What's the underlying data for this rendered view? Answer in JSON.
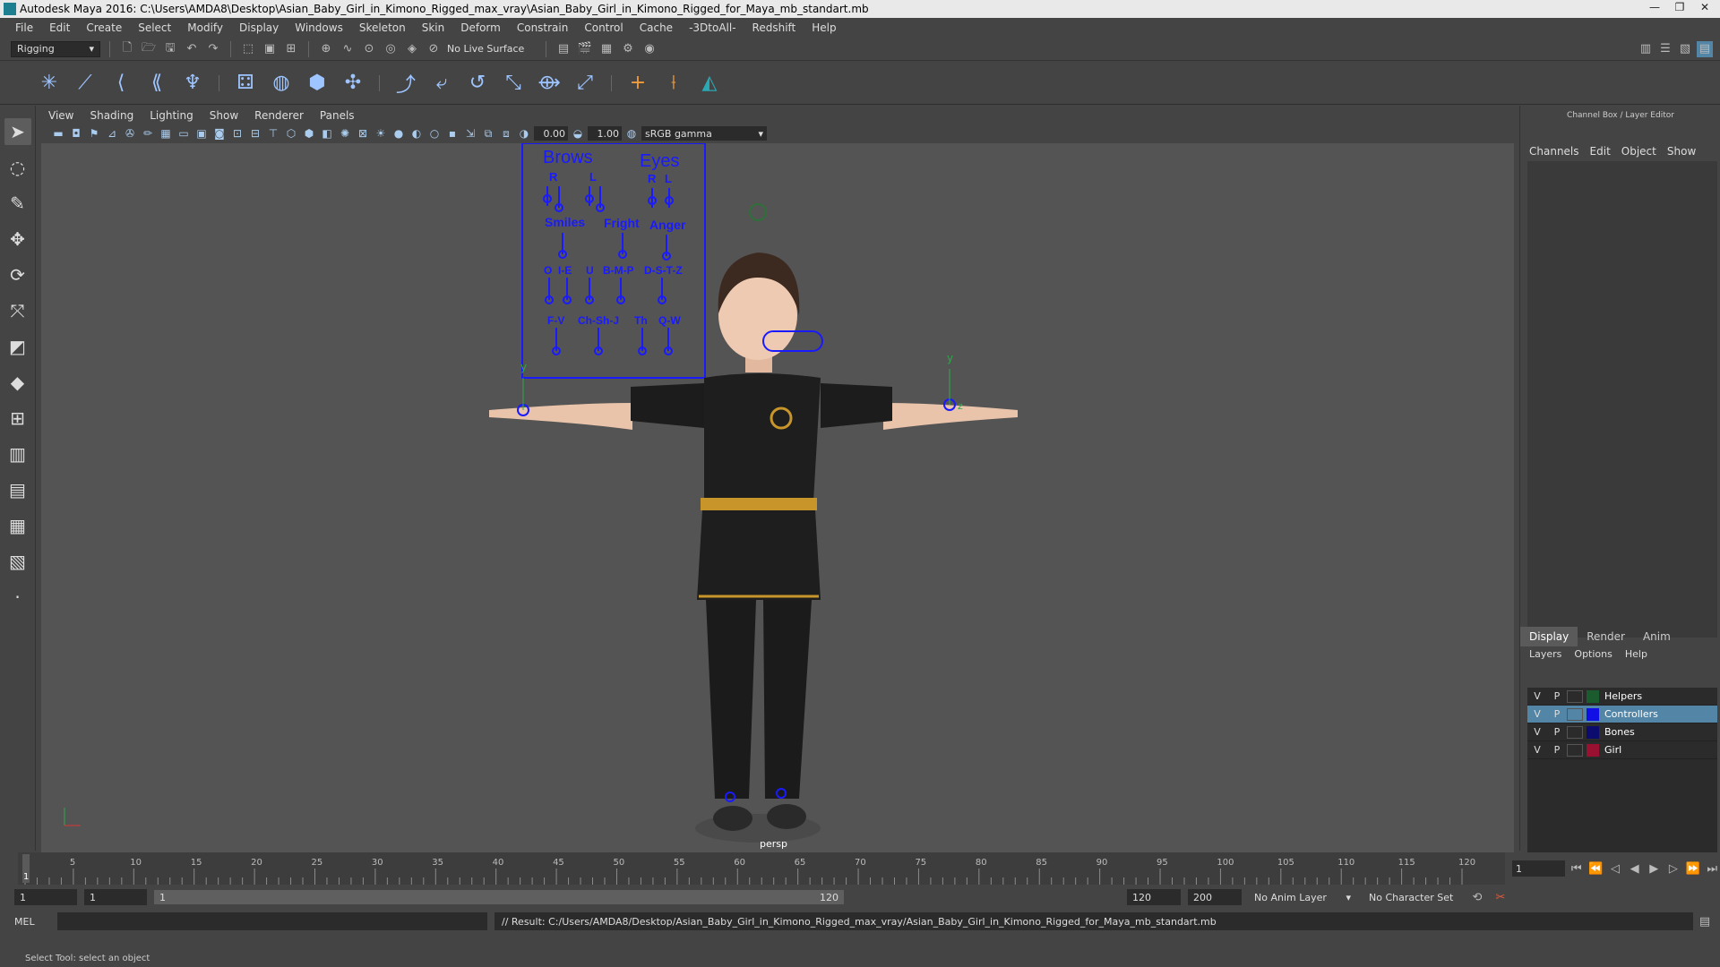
{
  "window": {
    "title": "Autodesk Maya 2016: C:\\Users\\AMDA8\\Desktop\\Asian_Baby_Girl_in_Kimono_Rigged_max_vray\\Asian_Baby_Girl_in_Kimono_Rigged_for_Maya_mb_standart.mb"
  },
  "menubar": [
    "File",
    "Edit",
    "Create",
    "Select",
    "Modify",
    "Display",
    "Windows",
    "Skeleton",
    "Skin",
    "Deform",
    "Constrain",
    "Control",
    "Cache",
    "-3DtoAll-",
    "Redshift",
    "Help"
  ],
  "statusline": {
    "menuset": "Rigging",
    "live_surface": "No Live Surface"
  },
  "viewport": {
    "menu": [
      "View",
      "Shading",
      "Lighting",
      "Show",
      "Renderer",
      "Panels"
    ],
    "exposure": "0.00",
    "gamma_value": "1.00",
    "color_space": "sRGB gamma",
    "camera_label": "persp"
  },
  "face_controls": {
    "brows": "Brows",
    "eyes": "Eyes",
    "r": "R",
    "l": "L",
    "smiles": "Smiles",
    "fright": "Fright",
    "anger": "Anger",
    "o": "O",
    "ie": "I-E",
    "u": "U",
    "bmp": "B-M-P",
    "dstz": "D-S-T-Z",
    "fv": "F-V",
    "chshj": "Ch-Sh-J",
    "th": "Th",
    "qw": "Q-W",
    "axis_y": "y",
    "axis_z": "z"
  },
  "channel_box": {
    "title": "Channel Box / Layer Editor",
    "tabs": [
      "Channels",
      "Edit",
      "Object",
      "Show"
    ]
  },
  "layer_editor": {
    "tabs": [
      "Display",
      "Render",
      "Anim"
    ],
    "menu": [
      "Layers",
      "Options",
      "Help"
    ],
    "visible_flag": "V",
    "playback_flag": "P",
    "layers": [
      {
        "name": "Helpers",
        "color": "#1a5c2e"
      },
      {
        "name": "Controllers",
        "color": "#1010e6"
      },
      {
        "name": "Bones",
        "color": "#0c0c6e"
      },
      {
        "name": "Girl",
        "color": "#9a1030"
      }
    ]
  },
  "timeline": {
    "ticks": [
      "5",
      "10",
      "15",
      "20",
      "25",
      "30",
      "35",
      "40",
      "45",
      "50",
      "55",
      "60",
      "65",
      "70",
      "75",
      "80",
      "85",
      "90",
      "95",
      "100",
      "105",
      "110",
      "115",
      "120"
    ],
    "current_frame_marker": "1",
    "current_frame": "1"
  },
  "range": {
    "start": "1",
    "playback_start": "1",
    "slider_start": "1",
    "slider_end": "120",
    "playback_end": "120",
    "end": "200",
    "anim_layer": "No Anim Layer",
    "character_set": "No Character Set"
  },
  "command": {
    "language": "MEL",
    "result": "// Result: C:/Users/AMDA8/Desktop/Asian_Baby_Girl_in_Kimono_Rigged_max_vray/Asian_Baby_Girl_in_Kimono_Rigged_for_Maya_mb_standart.mb"
  },
  "help_line": "Select Tool: select an object"
}
